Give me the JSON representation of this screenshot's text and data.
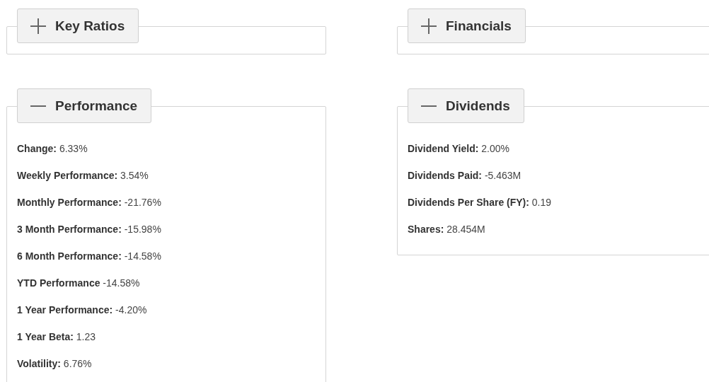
{
  "columns": [
    {
      "sections": [
        {
          "title": "Key Ratios",
          "expanded": false
        },
        {
          "title": "Performance",
          "expanded": true,
          "items": [
            "**Change:** 6.33%",
            "**Weekly Performance:** 3.54%",
            "**Monthly Performance:** -21.76%",
            "**3 Month Performance:** -15.98%",
            "**6 Month Performance:** -14.58%",
            "**YTD Performance** -14.58%",
            "**1 Year Performance:** -4.20%",
            "**1 Year Beta:** 1.23",
            "**Volatility:** 6.76%"
          ]
        }
      ]
    },
    {
      "sections": [
        {
          "title": "Financials",
          "expanded": false
        },
        {
          "title": "Dividends",
          "expanded": true,
          "items": [
            "**Dividend Yield:** 2.00%",
            "**Dividends Paid:** -5.463M",
            "**Dividends Per Share (FY):** 0.19",
            "**Shares:** 28.454M"
          ]
        }
      ]
    }
  ]
}
